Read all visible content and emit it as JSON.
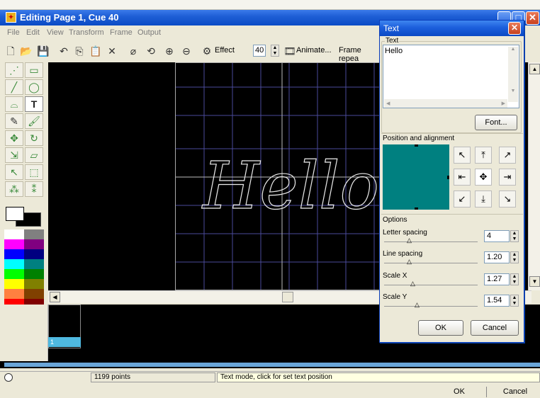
{
  "window": {
    "title": "Editing Page 1, Cue 40",
    "app_icon": "app-icon"
  },
  "menu": [
    "File",
    "Edit",
    "View",
    "Transform",
    "Frame",
    "Output"
  ],
  "toolbar": {
    "effect_label": "Effect",
    "cue_value": "40",
    "animate_label": "Animate...",
    "frame_repeat_label": "Frame repea"
  },
  "canvas": {
    "text": "Hello"
  },
  "timeline": {
    "frame_label": "1"
  },
  "status": {
    "points": "1199 points",
    "mode": "Text mode, click for set text position"
  },
  "bottom": {
    "ok": "OK",
    "cancel": "Cancel"
  },
  "dialog": {
    "title": "Text",
    "text_group": "Text",
    "text_value": "Hello",
    "font_button": "Font...",
    "position_group": "Position and alignment",
    "options_group": "Options",
    "letter_spacing_label": "Letter spacing",
    "letter_spacing_value": "4",
    "line_spacing_label": "Line spacing",
    "line_spacing_value": "1.20",
    "scale_x_label": "Scale X",
    "scale_x_value": "1.27",
    "scale_y_label": "Scale Y",
    "scale_y_value": "1.54",
    "ok": "OK",
    "cancel": "Cancel"
  },
  "colors": {
    "palette": [
      "#ffffff",
      "#808080",
      "#ff00ff",
      "#800080",
      "#0000ff",
      "#000080",
      "#00ffff",
      "#008080",
      "#00ff00",
      "#008000",
      "#ffff00",
      "#808000",
      "#ff8040",
      "#804000",
      "#ff0000",
      "#800000"
    ],
    "accent": "#008080"
  }
}
